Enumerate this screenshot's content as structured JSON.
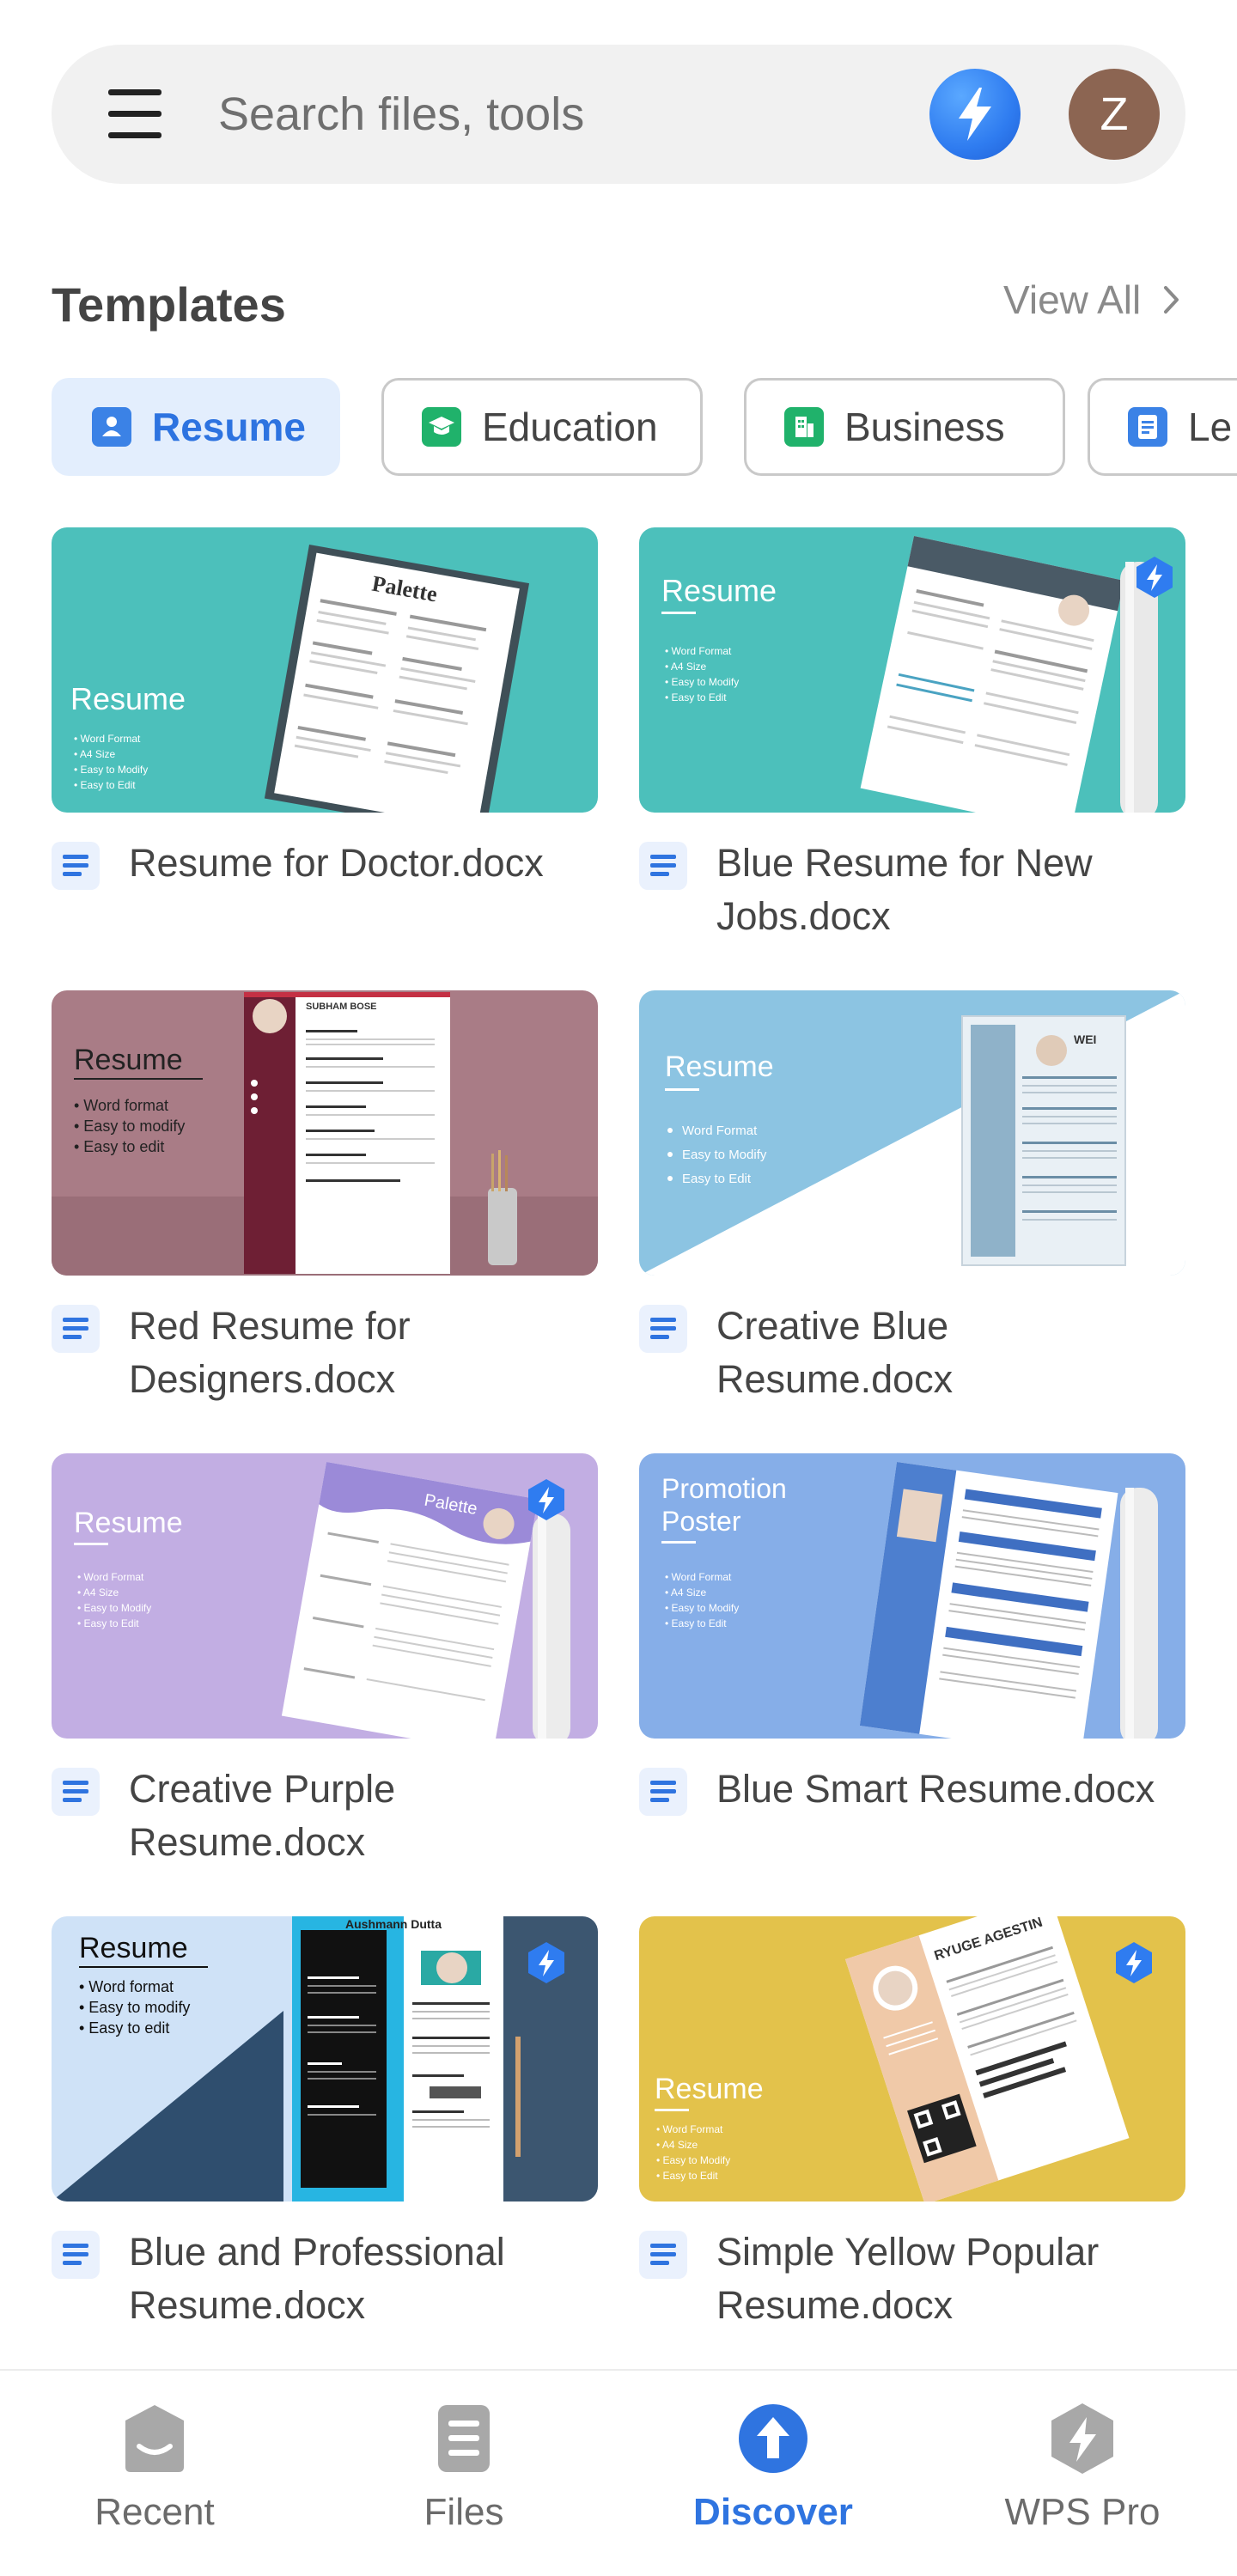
{
  "search": {
    "placeholder": "Search files, tools",
    "avatar_letter": "Z"
  },
  "section": {
    "title": "Templates",
    "view_all": "View All"
  },
  "chips": [
    {
      "label": "Resume",
      "icon": "person-card-icon",
      "color": "#3b82e6",
      "active": true
    },
    {
      "label": "Education",
      "icon": "graduation-cap-icon",
      "color": "#20b26b",
      "active": false
    },
    {
      "label": "Business",
      "icon": "building-icon",
      "color": "#20b26b",
      "active": false
    },
    {
      "label": "Le",
      "icon": "document-icon",
      "color": "#3b82e6",
      "active": false
    }
  ],
  "templates": [
    {
      "title": "Resume for Doctor.docx",
      "thumb_text": "Resume",
      "doc_name": "Palette",
      "premium": false
    },
    {
      "title": "Blue Resume for New\nJobs.docx",
      "thumb_text": "Resume",
      "doc_name": "",
      "premium": true
    },
    {
      "title": "Red Resume for\nDesigners.docx",
      "thumb_text": "Resume",
      "doc_name": "SUBHAM BOSE",
      "premium": false
    },
    {
      "title": "Creative Blue\nResume.docx",
      "thumb_text": "Resume",
      "doc_name": "WEI",
      "premium": false
    },
    {
      "title": "Creative  Purple\nResume.docx",
      "thumb_text": "Resume",
      "doc_name": "Palette",
      "premium": true
    },
    {
      "title": "Blue Smart Resume.docx",
      "thumb_text": "Promotion\nPoster",
      "doc_name": "",
      "premium": false
    },
    {
      "title": "Blue and Professional\nResume.docx",
      "thumb_text": "Resume",
      "doc_name": "Aushmann Dutta",
      "premium": true
    },
    {
      "title": "Simple Yellow Popular\nResume.docx",
      "thumb_text": "Resume",
      "doc_name": "RYUGE AGESTIN",
      "premium": true
    }
  ],
  "thumb_bullets_small": [
    "• Word Format",
    "• A4 Size",
    "• Easy to Modify",
    "• Easy to Edit"
  ],
  "thumb_bullets_large": [
    "• Word format",
    "• Easy to modify",
    "• Easy to edit"
  ],
  "thumb_bullets_blue": [
    "Word Format",
    "Easy to Modify",
    "Easy to Edit"
  ],
  "bottom_nav": [
    {
      "label": "Recent",
      "icon": "recent-icon",
      "active": false
    },
    {
      "label": "Files",
      "icon": "files-icon",
      "active": false
    },
    {
      "label": "Discover",
      "icon": "discover-icon",
      "active": true
    },
    {
      "label": "WPS Pro",
      "icon": "wps-pro-icon",
      "active": false
    }
  ],
  "colors": {
    "accent": "#2f74e0",
    "teal": "#4cc0bb",
    "rose": "#a97c86",
    "sky": "#8cc4e2",
    "lavender": "#c2aee3",
    "periwinkle": "#86aee8",
    "mustard": "#e3c24b"
  }
}
